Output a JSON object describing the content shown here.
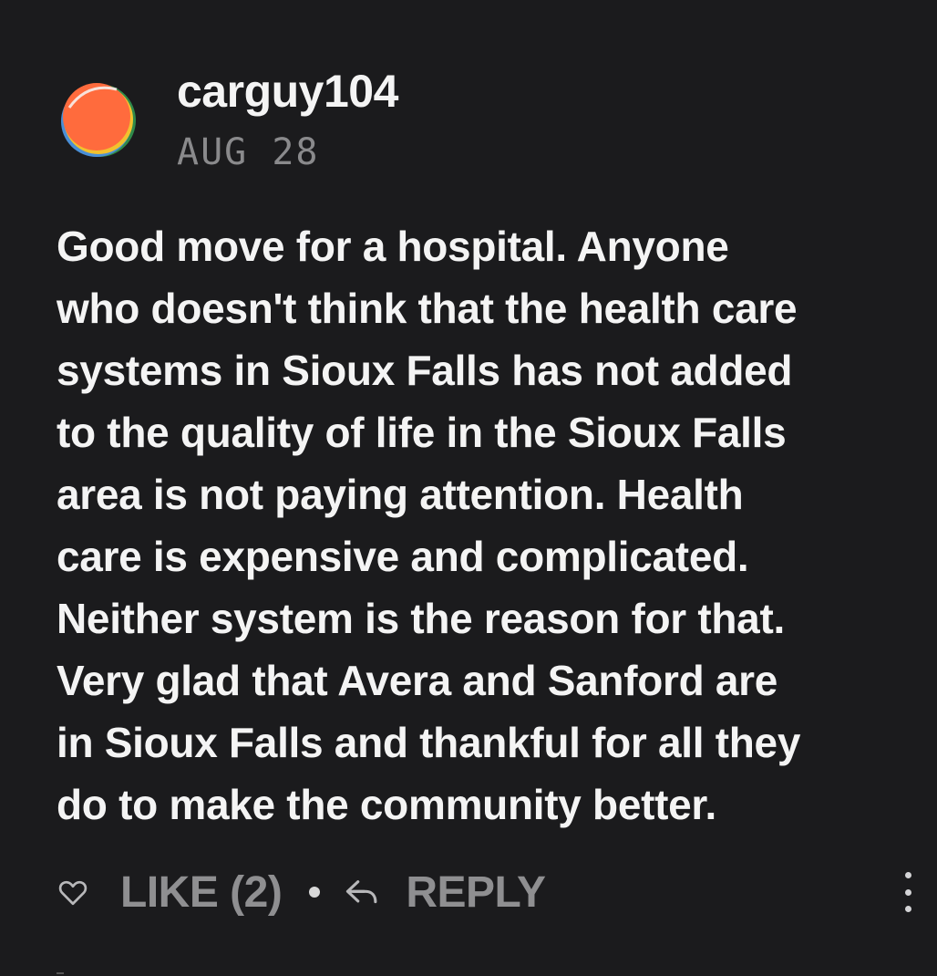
{
  "comment": {
    "author": "carguy104",
    "date": "AUG 28",
    "text": "Good move for a hospital.  Anyone\nwho doesn't think that the health care\nsystems in Sioux Falls has not added\nto the quality of life in the Sioux Falls\narea is not paying attention.  Health\ncare is expensive and complicated.\nNeither system is the reason for that.\nVery glad that Avera and Sanford are\nin Sioux Falls and thankful for all they\ndo to make the community better.",
    "avatar_icon": "orange-circle-avatar",
    "avatar_colors": {
      "main": "#ff6b3d",
      "accent_blue": "#4a8fd6",
      "accent_green": "#2f8a4a",
      "accent_yellow": "#f2c12e"
    }
  },
  "actions": {
    "like_icon": "heart-icon",
    "like_label": "LIKE (2)",
    "reply_icon": "reply-arrow-icon",
    "reply_label": "REPLY",
    "more_icon": "vertical-ellipsis-icon"
  },
  "colors": {
    "background": "#1b1b1d",
    "text": "#f4f4f4",
    "muted": "#8f8f91"
  }
}
